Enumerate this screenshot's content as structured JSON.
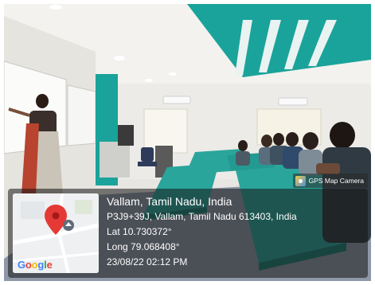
{
  "badge": {
    "icon": "map-camera-icon",
    "label": "GPS Map Camera"
  },
  "location": {
    "place": "Vallam, Tamil Nadu, India",
    "address": "P3J9+39J, Vallam, Tamil Nadu 613403, India",
    "latitude": "Lat 10.730372°",
    "longitude": "Long 79.068408°",
    "datetime": "23/08/22 02:12 PM"
  },
  "map": {
    "brand": "Google",
    "marker_icon": "location-pin-icon",
    "marker_color": "#e53935",
    "brand_colors": [
      "#4285f4",
      "#ea4335",
      "#fbbc05",
      "#4285f4",
      "#34a853",
      "#ea4335"
    ]
  },
  "scene": {
    "accent_color": "#1aa39a",
    "desk_color": "#2aa59b"
  }
}
